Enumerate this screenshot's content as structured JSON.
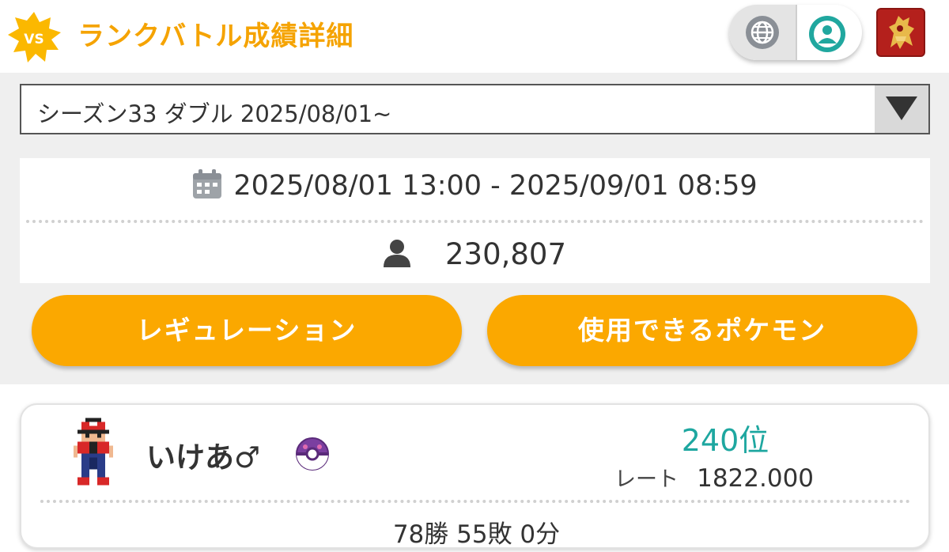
{
  "header": {
    "badge_text": "VS",
    "title": "ランクバトル成績詳細",
    "icons": {
      "globe": "globe-icon",
      "profile": "profile-icon",
      "avatar": "trainer-avatar"
    },
    "colors": {
      "title": "#f5a300",
      "badge": "#fbb800",
      "profile_active": "#20a79f"
    }
  },
  "season_select": {
    "selected": "シーズン33 ダブル 2025/08/01~",
    "arrow_icon": "triangle-down-icon"
  },
  "season_info": {
    "period": "2025/08/01 13:00 - 2025/09/01 08:59",
    "players": "230,807",
    "icons": {
      "calendar": "calendar-icon",
      "person": "person-icon"
    }
  },
  "buttons": {
    "regulation": "レギュレーション",
    "usable_pokemon": "使用できるポケモン",
    "color": "#fba800"
  },
  "record": {
    "name": "いけあ♂",
    "rank": "240位",
    "rate_label": "レート",
    "rate_value": "1822.000",
    "wld": "78勝 55敗 0分",
    "icons": {
      "ball": "master-ball-icon",
      "sprite": "trainer-sprite"
    },
    "colors": {
      "rank": "#1ea7a0"
    }
  }
}
